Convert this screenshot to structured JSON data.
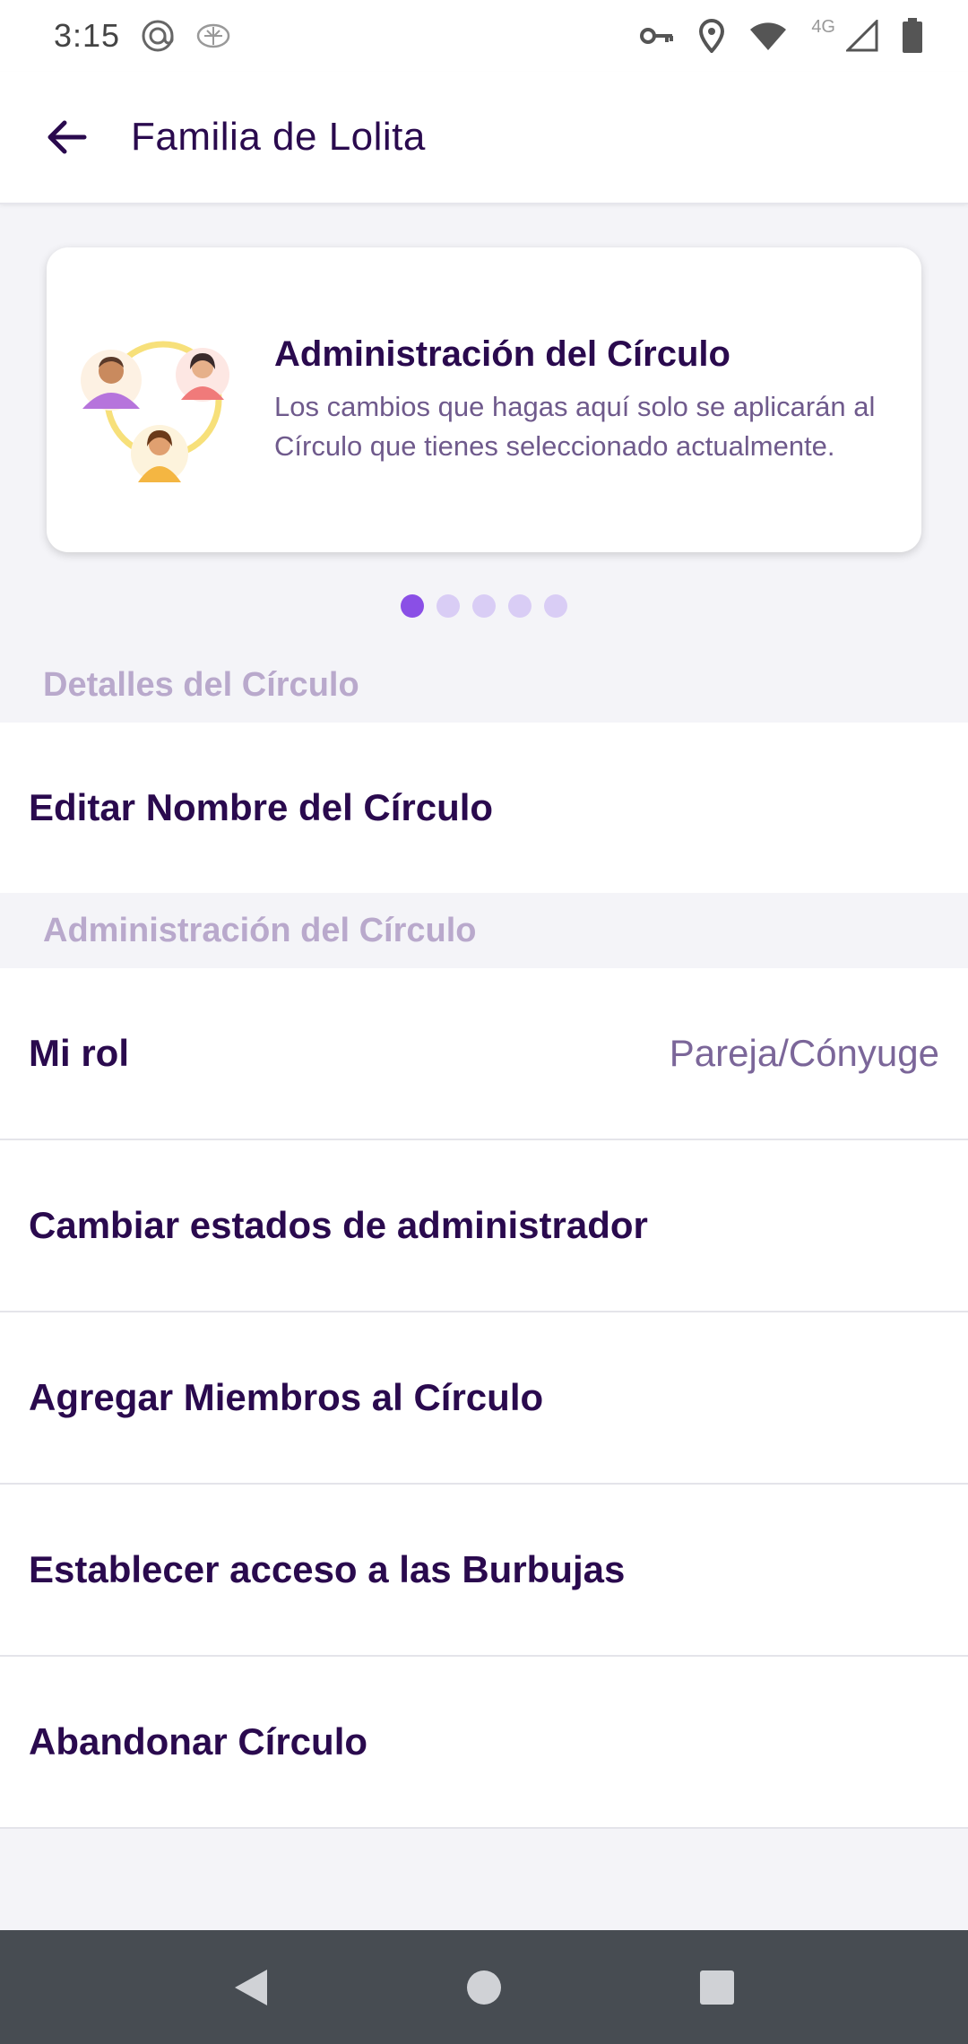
{
  "status_bar": {
    "time": "3:15",
    "network_label": "4G",
    "icons": [
      "at-sign-icon",
      "brain-icon",
      "vpn-key-icon",
      "location-pin-icon",
      "wifi-icon",
      "cell-signal-icon",
      "battery-icon"
    ]
  },
  "app_bar": {
    "title": "Familia de Lolita",
    "back_icon": "arrow-left-icon"
  },
  "carousel": {
    "card_title": "Administración del Círculo",
    "card_body": "Los cambios que hagas aquí solo se aplicarán al Círculo que tienes seleccionado actualmente.",
    "page_count": 5,
    "active_page": 1
  },
  "sections": {
    "details_header": "Detalles del Círculo",
    "admin_header": "Administración del Círculo"
  },
  "rows": {
    "edit_name": "Editar Nombre del Círculo",
    "my_role_label": "Mi rol",
    "my_role_value": "Pareja/Cónyuge",
    "change_admin": "Cambiar estados de administrador",
    "add_members": "Agregar Miembros al Círculo",
    "bubbles_access": "Establecer acceso a las Burbujas",
    "leave_circle": "Abandonar Círculo"
  },
  "colors": {
    "primary_text": "#2a0a4e",
    "secondary_text": "#7b6699",
    "section_header": "#b9a9cc",
    "accent_active_dot": "#8a4fe6",
    "inactive_dot": "#d9cdf5",
    "nav_bar": "#474c52"
  }
}
